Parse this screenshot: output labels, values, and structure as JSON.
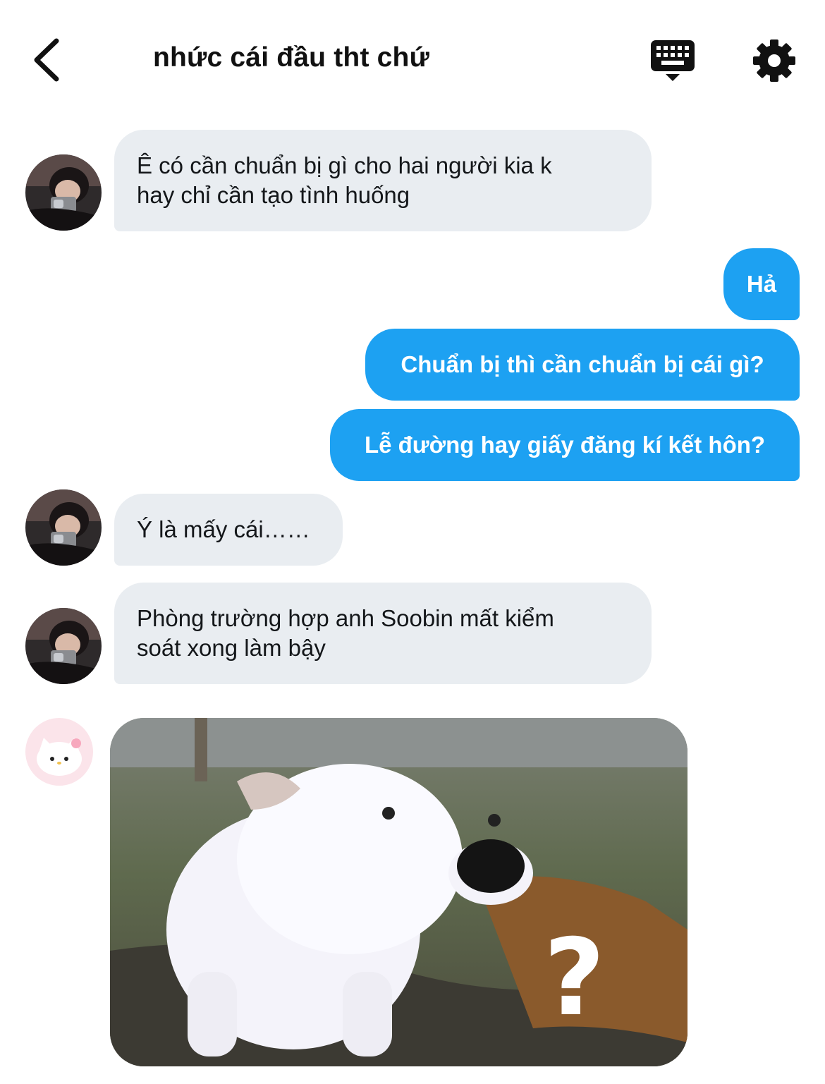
{
  "header": {
    "title": "nhức cái đầu tht chứ",
    "back_icon": "chevron-left-icon",
    "keyboard_icon": "keyboard-icon",
    "settings_icon": "gear-icon"
  },
  "messages": [
    {
      "sender": "other",
      "text_lines": [
        "Ê có cần chuẩn bị gì cho hai người kia k",
        "hay chỉ cần tạo tình huống"
      ]
    },
    {
      "sender": "me",
      "text": "Hả"
    },
    {
      "sender": "me",
      "text": "Chuẩn bị thì cần chuẩn bị cái gì?"
    },
    {
      "sender": "me",
      "text": "Lễ đường hay giấy đăng kí kết hôn?"
    },
    {
      "sender": "other",
      "text": "Ý là mấy cái……"
    },
    {
      "sender": "other",
      "text_lines": [
        "Phòng trường hợp anh Soobin mất kiểm",
        "soát xong làm bậy"
      ]
    },
    {
      "sender": "other2",
      "type": "image",
      "overlay_text": "?"
    }
  ],
  "colors": {
    "outgoing_bubble": "#1da1f2",
    "incoming_bubble": "#e9edf1",
    "background": "#ffffff"
  }
}
